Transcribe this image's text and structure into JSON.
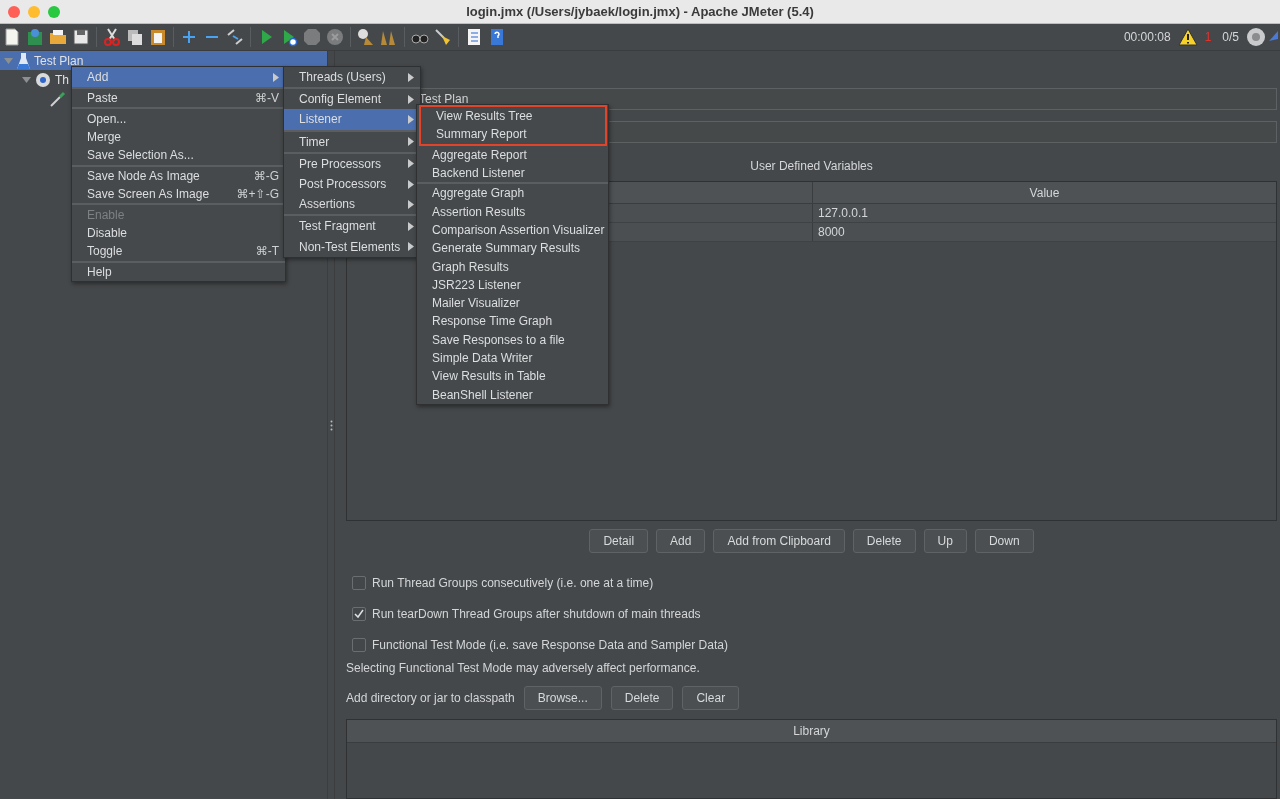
{
  "window": {
    "title": "login.jmx (/Users/jybaek/login.jmx) - Apache JMeter (5.4)"
  },
  "status": {
    "elapsed": "00:00:08",
    "warnings": "1",
    "threads": "0/5"
  },
  "tree": [
    {
      "label": "Test Plan",
      "selected": true,
      "expanded": true,
      "children": [
        {
          "label": "Th",
          "selected": false,
          "expanded": true,
          "children": [
            {
              "selected": false
            }
          ]
        }
      ]
    }
  ],
  "form": {
    "name": "Test Plan",
    "variables_title": "User Defined Variables",
    "columns": [
      "Value"
    ],
    "rows": [
      [
        "127.0.0.1"
      ],
      [
        "8000"
      ]
    ],
    "table_buttons": [
      "Detail",
      "Add",
      "Add from Clipboard",
      "Delete",
      "Up",
      "Down"
    ],
    "options": [
      {
        "label": "Run Thread Groups consecutively (i.e. one at a time)",
        "checked": false
      },
      {
        "label": "Run tearDown Thread Groups after shutdown of main threads",
        "checked": true
      },
      {
        "label": "Functional Test Mode (i.e. save Response Data and Sampler Data)",
        "checked": false
      }
    ],
    "note": "Selecting Functional Test Mode may adversely affect performance.",
    "classpath_label": "Add directory or jar to classpath",
    "classpath_buttons": [
      "Browse...",
      "Delete",
      "Clear"
    ],
    "library_column": "Library"
  },
  "context_menu": [
    {
      "label": "Add",
      "submenu": true,
      "selected": true,
      "disabled": false,
      "separator_before": false
    },
    {
      "label": "Paste",
      "shortcut": "⌘-V",
      "selected": false,
      "disabled": false,
      "separator_before": true
    },
    {
      "label": "Open...",
      "selected": false,
      "disabled": false,
      "separator_before": true
    },
    {
      "label": "Merge",
      "selected": false,
      "disabled": false,
      "separator_before": false
    },
    {
      "label": "Save Selection As...",
      "selected": false,
      "disabled": false,
      "separator_before": false
    },
    {
      "label": "Save Node As Image",
      "shortcut": "⌘-G",
      "selected": false,
      "disabled": false,
      "separator_before": true
    },
    {
      "label": "Save Screen As Image",
      "shortcut": "⌘+⇧-G",
      "selected": false,
      "disabled": false,
      "separator_before": false
    },
    {
      "label": "Enable",
      "selected": false,
      "disabled": true,
      "separator_before": true
    },
    {
      "label": "Disable",
      "selected": false,
      "disabled": false,
      "separator_before": false
    },
    {
      "label": "Toggle",
      "shortcut": "⌘-T",
      "selected": false,
      "disabled": false,
      "separator_before": false
    },
    {
      "label": "Help",
      "selected": false,
      "disabled": false,
      "separator_before": true
    }
  ],
  "add_menu": [
    {
      "label": "Threads (Users)",
      "selected": false,
      "separator_before": false
    },
    {
      "label": "Config Element",
      "selected": false,
      "separator_before": true
    },
    {
      "label": "Listener",
      "selected": true,
      "separator_before": false
    },
    {
      "label": "Timer",
      "selected": false,
      "separator_before": true
    },
    {
      "label": "Pre Processors",
      "selected": false,
      "separator_before": true
    },
    {
      "label": "Post Processors",
      "selected": false,
      "separator_before": false
    },
    {
      "label": "Assertions",
      "selected": false,
      "separator_before": false
    },
    {
      "label": "Test Fragment",
      "selected": false,
      "separator_before": true
    },
    {
      "label": "Non-Test Elements",
      "selected": false,
      "separator_before": false
    }
  ],
  "listener_menu": [
    {
      "label": "View Results Tree",
      "boxed": true,
      "separator_before": false
    },
    {
      "label": "Summary Report",
      "boxed": true,
      "separator_before": false
    },
    {
      "label": "Aggregate Report",
      "boxed": false,
      "separator_before": false
    },
    {
      "label": "Backend Listener",
      "boxed": false,
      "separator_before": false
    },
    {
      "label": "Aggregate Graph",
      "boxed": false,
      "separator_before": true
    },
    {
      "label": "Assertion Results",
      "boxed": false,
      "separator_before": false
    },
    {
      "label": "Comparison Assertion Visualizer",
      "boxed": false,
      "separator_before": false
    },
    {
      "label": "Generate Summary Results",
      "boxed": false,
      "separator_before": false
    },
    {
      "label": "Graph Results",
      "boxed": false,
      "separator_before": false
    },
    {
      "label": "JSR223 Listener",
      "boxed": false,
      "separator_before": false
    },
    {
      "label": "Mailer Visualizer",
      "boxed": false,
      "separator_before": false
    },
    {
      "label": "Response Time Graph",
      "boxed": false,
      "separator_before": false
    },
    {
      "label": "Save Responses to a file",
      "boxed": false,
      "separator_before": false
    },
    {
      "label": "Simple Data Writer",
      "boxed": false,
      "separator_before": false
    },
    {
      "label": "View Results in Table",
      "boxed": false,
      "separator_before": false
    },
    {
      "label": "BeanShell Listener",
      "boxed": false,
      "separator_before": false
    }
  ]
}
